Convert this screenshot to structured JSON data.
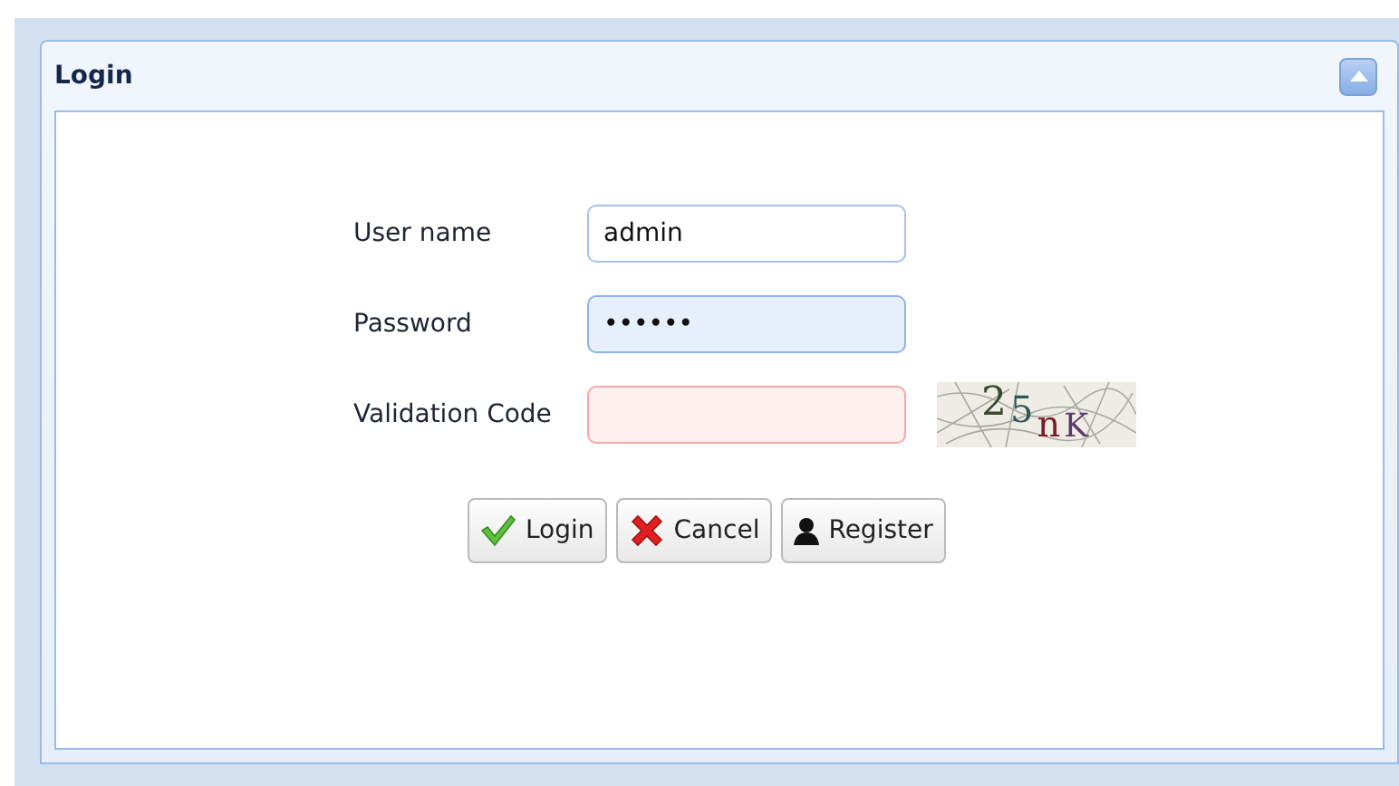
{
  "panel": {
    "title": "Login",
    "collapsed": false
  },
  "fields": [
    {
      "label": "User name",
      "value": "admin",
      "focused": false,
      "invalid": false
    },
    {
      "label": "Password",
      "value": "••••••",
      "focused": true,
      "invalid": false
    },
    {
      "label": "Validation Code",
      "focused": false,
      "invalid": true
    }
  ],
  "captcha": {
    "text": "25nK"
  },
  "buttons": [
    {
      "label": "Login",
      "kind": "check"
    },
    {
      "label": "Cancel",
      "kind": "cross"
    },
    {
      "label": "Register",
      "kind": "person"
    }
  ]
}
